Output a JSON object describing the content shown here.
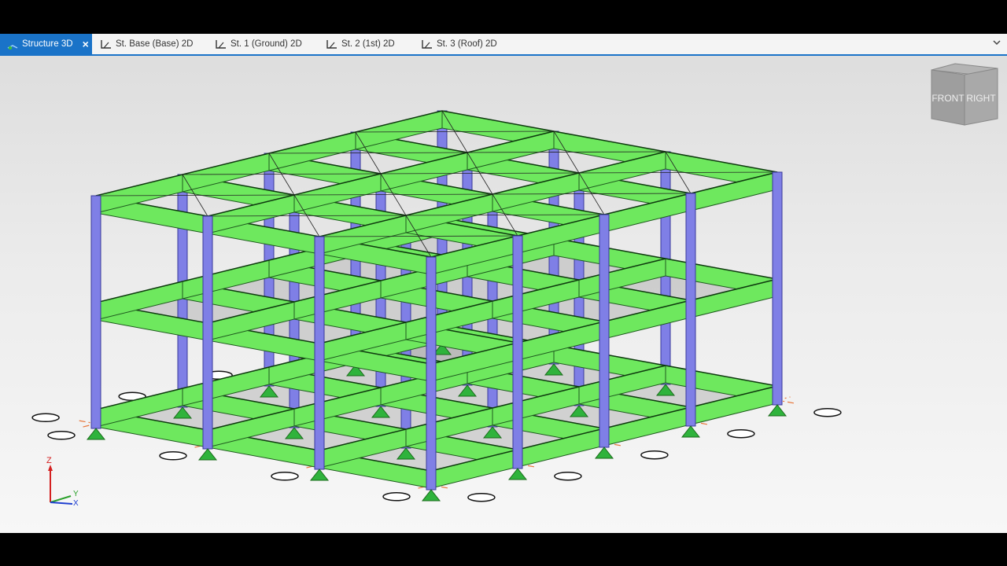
{
  "tabs": [
    {
      "label": "Structure 3D",
      "icon": "structure-3d-icon",
      "active": true
    },
    {
      "label": "St. Base (Base) 2D",
      "icon": "plan-2d-icon"
    },
    {
      "label": "St. 1 (Ground) 2D",
      "icon": "plan-2d-icon"
    },
    {
      "label": "St. 2 (1st) 2D",
      "icon": "plan-2d-icon"
    },
    {
      "label": "St. 3 (Roof) 2D",
      "icon": "plan-2d-icon"
    }
  ],
  "view_cube": {
    "front": "FRONT",
    "right": "RIGHT"
  },
  "axes": {
    "z": "Z",
    "y": "Y",
    "x": "X"
  },
  "colors": {
    "beam": "#6ee85e",
    "column": "#7f7fe6",
    "support": "#2fb33c",
    "gridline": "#e8763a",
    "active_tab": "#1a73c8"
  }
}
